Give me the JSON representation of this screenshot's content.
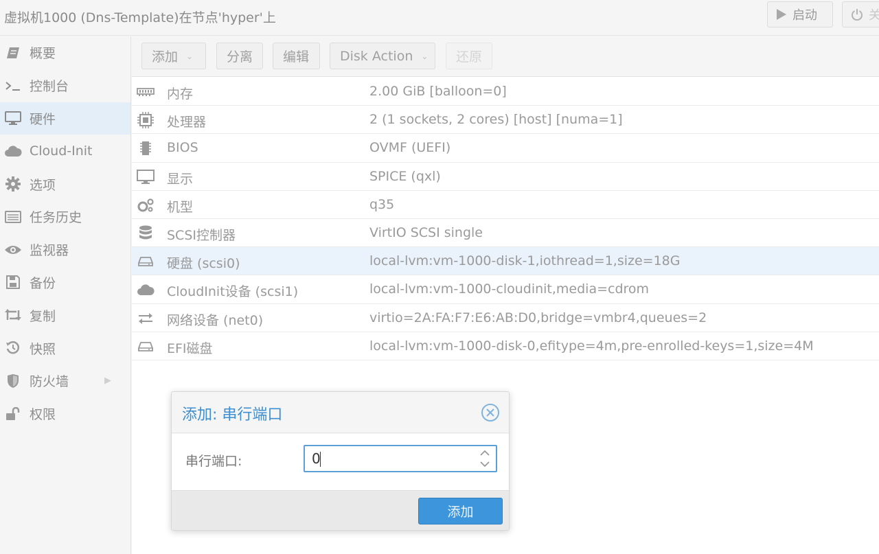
{
  "window": {
    "title": "虚拟机1000 (Dns-Template)在节点'hyper'上",
    "start_label": "启动",
    "shutdown_label": "关"
  },
  "sidebar": {
    "items": [
      {
        "label": "概要",
        "icon": "summary-book-icon"
      },
      {
        "label": "控制台",
        "icon": "terminal-icon"
      },
      {
        "label": "硬件",
        "icon": "monitor-icon",
        "active": true
      },
      {
        "label": "Cloud-Init",
        "icon": "cloud-icon"
      },
      {
        "label": "选项",
        "icon": "gear-icon"
      },
      {
        "label": "任务历史",
        "icon": "list-icon"
      },
      {
        "label": "监视器",
        "icon": "eye-icon"
      },
      {
        "label": "备份",
        "icon": "floppy-icon"
      },
      {
        "label": "复制",
        "icon": "retweet-icon"
      },
      {
        "label": "快照",
        "icon": "history-icon"
      },
      {
        "label": "防火墙",
        "icon": "shield-icon",
        "has_submenu": true
      },
      {
        "label": "权限",
        "icon": "unlock-icon"
      }
    ]
  },
  "toolbar": {
    "add_label": "添加",
    "detach_label": "分离",
    "edit_label": "编辑",
    "disk_action_label": "Disk Action",
    "revert_label": "还原"
  },
  "hardware": {
    "rows": [
      {
        "name": "内存",
        "value": "2.00 GiB [balloon=0]",
        "icon": "memory-icon"
      },
      {
        "name": "处理器",
        "value": "2 (1 sockets, 2 cores) [host] [numa=1]",
        "icon": "cpu-icon"
      },
      {
        "name": "BIOS",
        "value": "OVMF (UEFI)",
        "icon": "microchip-icon"
      },
      {
        "name": "显示",
        "value": "SPICE (qxl)",
        "icon": "desktop-icon"
      },
      {
        "name": "机型",
        "value": "q35",
        "icon": "cogs-icon"
      },
      {
        "name": "SCSI控制器",
        "value": "VirtIO SCSI single",
        "icon": "database-icon"
      },
      {
        "name": "硬盘 (scsi0)",
        "value": "local-lvm:vm-1000-disk-1,iothread=1,size=18G",
        "icon": "hdd-icon",
        "selected": true
      },
      {
        "name": "CloudInit设备 (scsi1)",
        "value": "local-lvm:vm-1000-cloudinit,media=cdrom",
        "icon": "cloud-icon"
      },
      {
        "name": "网络设备 (net0)",
        "value": "virtio=2A:FA:F7:E6:AB:D0,bridge=vmbr4,queues=2",
        "icon": "exchange-icon"
      },
      {
        "name": "EFI磁盘",
        "value": "local-lvm:vm-1000-disk-0,efitype=4m,pre-enrolled-keys=1,size=4M",
        "icon": "hdd-icon"
      }
    ]
  },
  "dialog": {
    "title": "添加: 串行端口",
    "field_label": "串行端口:",
    "field_value": "0",
    "submit_label": "添加"
  },
  "colors": {
    "accent": "#3d96dc",
    "title_blue": "#3d8fd1",
    "selected_row": "#eaf2fb"
  }
}
